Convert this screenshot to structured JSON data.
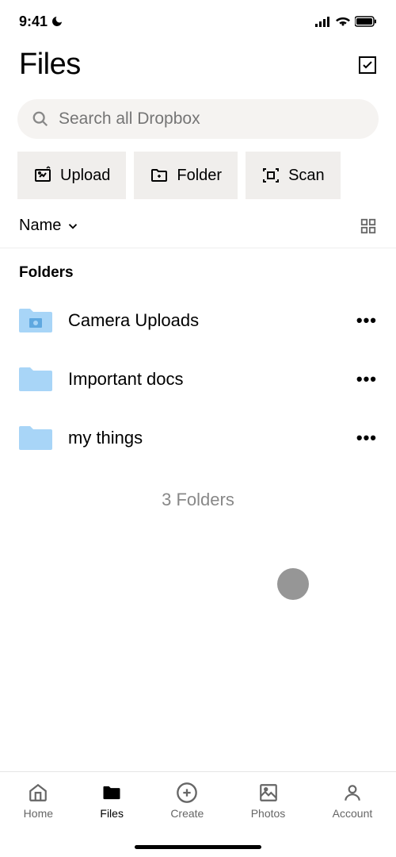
{
  "status": {
    "time": "9:41"
  },
  "header": {
    "title": "Files"
  },
  "search": {
    "placeholder": "Search all Dropbox"
  },
  "actions": {
    "upload": "Upload",
    "folder": "Folder",
    "scan": "Scan"
  },
  "sort": {
    "label": "Name"
  },
  "section": {
    "folders_title": "Folders"
  },
  "folders": [
    {
      "name": "Camera Uploads",
      "type": "camera"
    },
    {
      "name": "Important docs",
      "type": "plain"
    },
    {
      "name": "my things",
      "type": "plain"
    }
  ],
  "count": {
    "label": "3 Folders"
  },
  "tabs": {
    "home": "Home",
    "files": "Files",
    "create": "Create",
    "photos": "Photos",
    "account": "Account"
  }
}
